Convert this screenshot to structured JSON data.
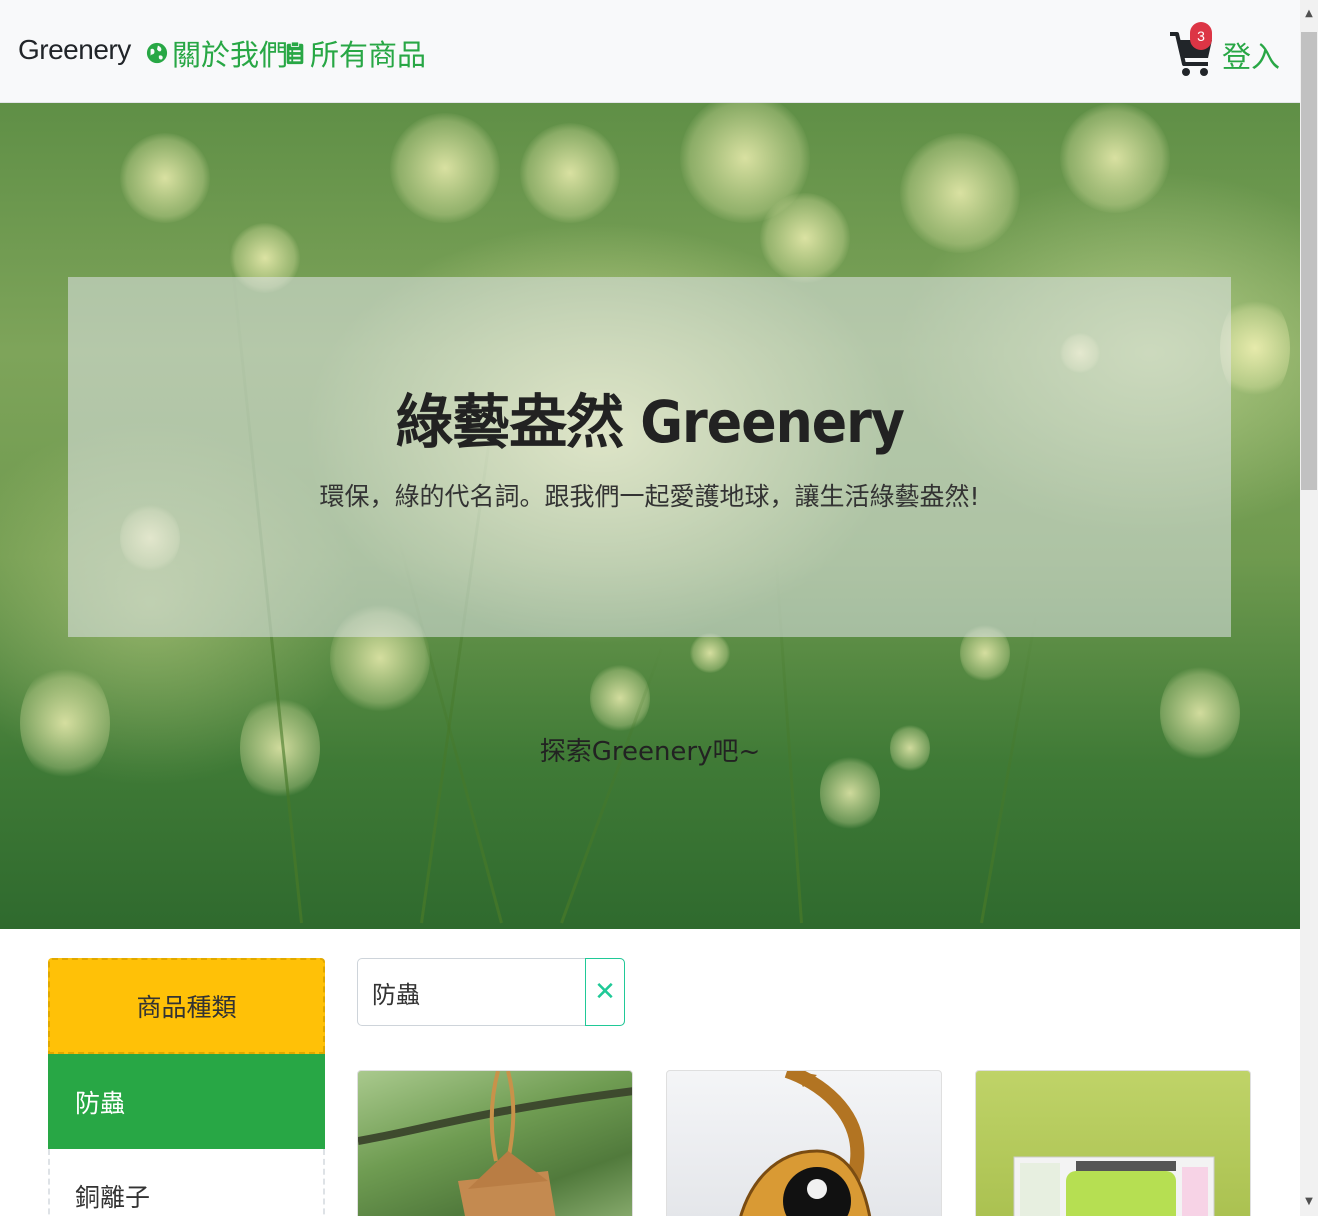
{
  "navbar": {
    "brand": "Greenery",
    "about_label": "關於我們",
    "products_label": "所有商品",
    "cart_count": "3",
    "login_label": "登入",
    "about_icon": "globe-icon",
    "products_icon": "clipboard-list-icon",
    "cart_icon": "shopping-cart-icon"
  },
  "hero": {
    "title": "綠藝盎然 Greenery",
    "subtitle": "環保，綠的代名詞。跟我們一起愛護地球，讓生活綠藝盎然!",
    "explore": "探索Greenery吧~"
  },
  "sidebar": {
    "header": "商品種類",
    "items": [
      {
        "label": "防蟲",
        "active": true
      },
      {
        "label": "銅離子",
        "active": false
      }
    ]
  },
  "search": {
    "value": "防蟲",
    "clear_icon": "close-icon"
  },
  "colors": {
    "primary_green": "#28a745",
    "warning_yellow": "#ffc107",
    "badge_red": "#dc3545",
    "teal": "#20c997"
  }
}
